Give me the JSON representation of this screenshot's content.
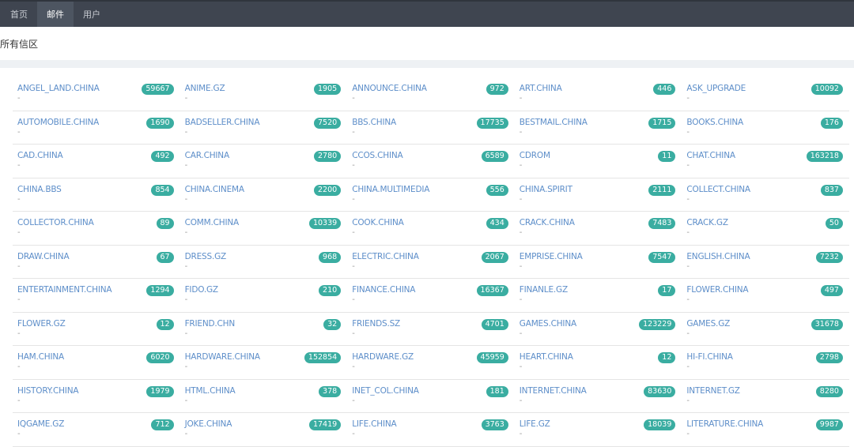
{
  "nav": [
    {
      "label": "首页"
    },
    {
      "label": "邮件",
      "active": true
    },
    {
      "label": "用户"
    }
  ],
  "page_title": "所有信区",
  "accent": "#3aada1",
  "boards": [
    [
      "ANGEL_LAND.CHINA",
      "59667"
    ],
    [
      "ANIME.GZ",
      "1905"
    ],
    [
      "ANNOUNCE.CHINA",
      "972"
    ],
    [
      "ART.CHINA",
      "446"
    ],
    [
      "ASK_UPGRADE",
      "10092"
    ],
    [
      "AUTOMOBILE.CHINA",
      "1690"
    ],
    [
      "BADSELLER.CHINA",
      "7520"
    ],
    [
      "BBS.CHINA",
      "17735"
    ],
    [
      "BESTMAIL.CHINA",
      "1715"
    ],
    [
      "BOOKS.CHINA",
      "176"
    ],
    [
      "CAD.CHINA",
      "492"
    ],
    [
      "CAR.CHINA",
      "2780"
    ],
    [
      "CCOS.CHINA",
      "6589"
    ],
    [
      "CDROM",
      "11"
    ],
    [
      "CHAT.CHINA",
      "163218"
    ],
    [
      "CHINA.BBS",
      "854"
    ],
    [
      "CHINA.CINEMA",
      "2200"
    ],
    [
      "CHINA.MULTIMEDIA",
      "556"
    ],
    [
      "CHINA.SPIRIT",
      "2111"
    ],
    [
      "COLLECT.CHINA",
      "837"
    ],
    [
      "COLLECTOR.CHINA",
      "89"
    ],
    [
      "COMM.CHINA",
      "10339"
    ],
    [
      "COOK.CHINA",
      "434"
    ],
    [
      "CRACK.CHINA",
      "7483"
    ],
    [
      "CRACK.GZ",
      "50"
    ],
    [
      "DRAW.CHINA",
      "67"
    ],
    [
      "DRESS.GZ",
      "968"
    ],
    [
      "ELECTRIC.CHINA",
      "2067"
    ],
    [
      "EMPRISE.CHINA",
      "7547"
    ],
    [
      "ENGLISH.CHINA",
      "7232"
    ],
    [
      "ENTERTAINMENT.CHINA",
      "1294"
    ],
    [
      "FIDO.GZ",
      "210"
    ],
    [
      "FINANCE.CHINA",
      "16367"
    ],
    [
      "FINANLE.GZ",
      "17"
    ],
    [
      "FLOWER.CHINA",
      "497"
    ],
    [
      "FLOWER.GZ",
      "12"
    ],
    [
      "FRIEND.CHN",
      "32"
    ],
    [
      "FRIENDS.SZ",
      "4701"
    ],
    [
      "GAMES.CHINA",
      "123229"
    ],
    [
      "GAMES.GZ",
      "31678"
    ],
    [
      "HAM.CHINA",
      "6020"
    ],
    [
      "HARDWARE.CHINA",
      "152854"
    ],
    [
      "HARDWARE.GZ",
      "45959"
    ],
    [
      "HEART.CHINA",
      "12"
    ],
    [
      "HI-FI.CHINA",
      "2798"
    ],
    [
      "HISTORY.CHINA",
      "1979"
    ],
    [
      "HTML.CHINA",
      "378"
    ],
    [
      "INET_COL.CHINA",
      "181"
    ],
    [
      "INTERNET.CHINA",
      "83630"
    ],
    [
      "INTERNET.GZ",
      "8280"
    ],
    [
      "IQGAME.GZ",
      "712"
    ],
    [
      "JOKE.CHINA",
      "17419"
    ],
    [
      "LIFE.CHINA",
      "3763"
    ],
    [
      "LIFE.GZ",
      "18039"
    ],
    [
      "LITERATURE.CHINA",
      "9987"
    ]
  ],
  "board_desc": "-"
}
